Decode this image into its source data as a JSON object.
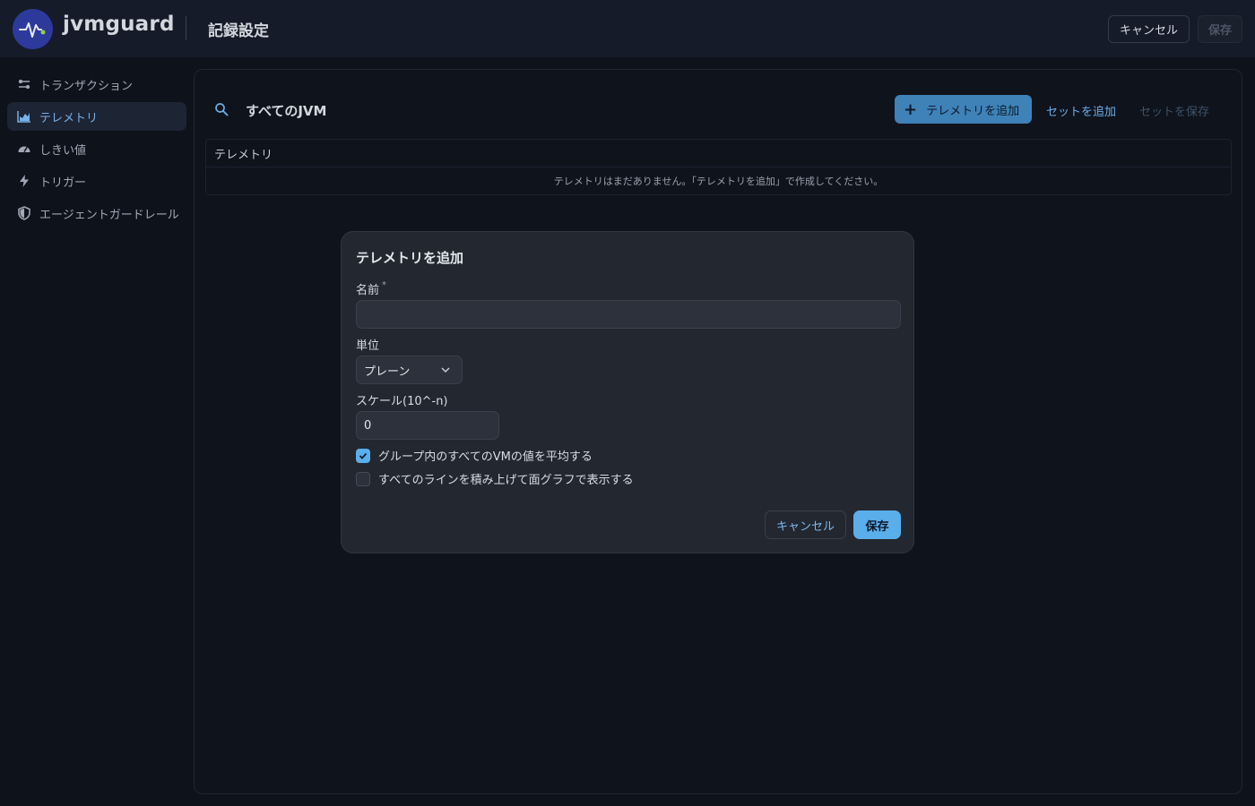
{
  "header": {
    "brand": "jvmguard",
    "title": "記録設定",
    "cancel_label": "キャンセル",
    "save_label": "保存"
  },
  "sidebar": {
    "items": [
      {
        "label": "トランザクション",
        "icon": "transactions-icon",
        "active": false
      },
      {
        "label": "テレメトリ",
        "icon": "chart-icon",
        "active": true
      },
      {
        "label": "しきい値",
        "icon": "gauge-icon",
        "active": false
      },
      {
        "label": "トリガー",
        "icon": "bolt-icon",
        "active": false
      },
      {
        "label": "エージェントガードレール",
        "icon": "shield-icon",
        "active": false
      }
    ]
  },
  "main": {
    "scope_label": "すべてのJVM",
    "add_telemetry_label": "テレメトリを追加",
    "add_set_label": "セットを追加",
    "save_set_label": "セットを保存",
    "table": {
      "header": "テレメトリ",
      "empty_message": "テレメトリはまだありません。「テレメトリを追加」で作成してください。"
    }
  },
  "modal": {
    "title": "テレメトリを追加",
    "name_label": "名前",
    "name_required_mark": "*",
    "name_value": "",
    "unit_label": "単位",
    "unit_value": "プレーン",
    "scale_label": "スケール(10^-n)",
    "scale_value": "0",
    "average_label": "グループ内のすべてのVMの値を平均する",
    "average_checked": true,
    "stack_label": "すべてのラインを積み上げて面グラフで表示する",
    "stack_checked": false,
    "cancel_label": "キャンセル",
    "save_label": "保存"
  },
  "colors": {
    "accent": "#5aaeea",
    "primary_button": "#3e82b8",
    "background": "#0e121b"
  }
}
